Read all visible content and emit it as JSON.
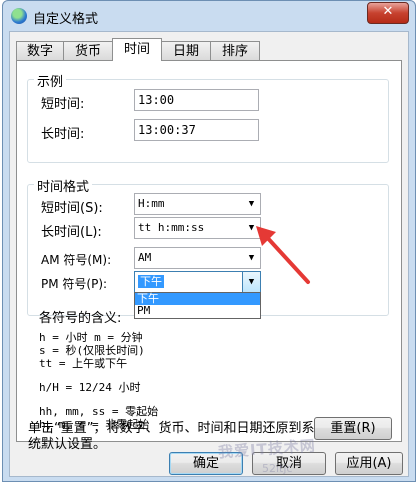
{
  "window": {
    "title": "自定义格式",
    "close_label": "✕"
  },
  "tabs": [
    {
      "label": "数字"
    },
    {
      "label": "货币"
    },
    {
      "label": "时间"
    },
    {
      "label": "日期"
    },
    {
      "label": "排序"
    }
  ],
  "active_tab": "时间",
  "example": {
    "title": "示例",
    "short_label": "短时间:",
    "short_value": "13:00",
    "long_label": "长时间:",
    "long_value": "13:00:37"
  },
  "time_format": {
    "title": "时间格式",
    "short_label": "短时间(S):",
    "short_value": "H:mm",
    "long_label": "长时间(L):",
    "long_value": "tt h:mm:ss",
    "am_label": "AM 符号(M):",
    "am_value": "AM",
    "pm_label": "PM 符号(P):",
    "pm_value": "下午",
    "pm_options": [
      "下午",
      "PM"
    ]
  },
  "legend": {
    "title": "各符号的含义:",
    "line1": "h = 小时   m = 分钟",
    "line2": "s = 秒(仅限长时间)",
    "line3": "tt = 上午或下午",
    "line4": "h/H = 12/24 小时",
    "line5": "hh, mm, ss = 零起始",
    "line6": "h, m, s = 非零起始"
  },
  "reset": {
    "text_line1": "单击“重置”，将数字、货币、时间和日期还原到系",
    "text_line2": "统默认设置。",
    "button": "重置(R)"
  },
  "buttons": {
    "ok": "确定",
    "cancel": "取消",
    "apply": "应用(A)"
  },
  "watermark": {
    "text": "我爱IT技术网",
    "sub": "52itjc"
  },
  "colors": {
    "annotation_arrow": "#e53935",
    "selection": "#3399ff"
  }
}
